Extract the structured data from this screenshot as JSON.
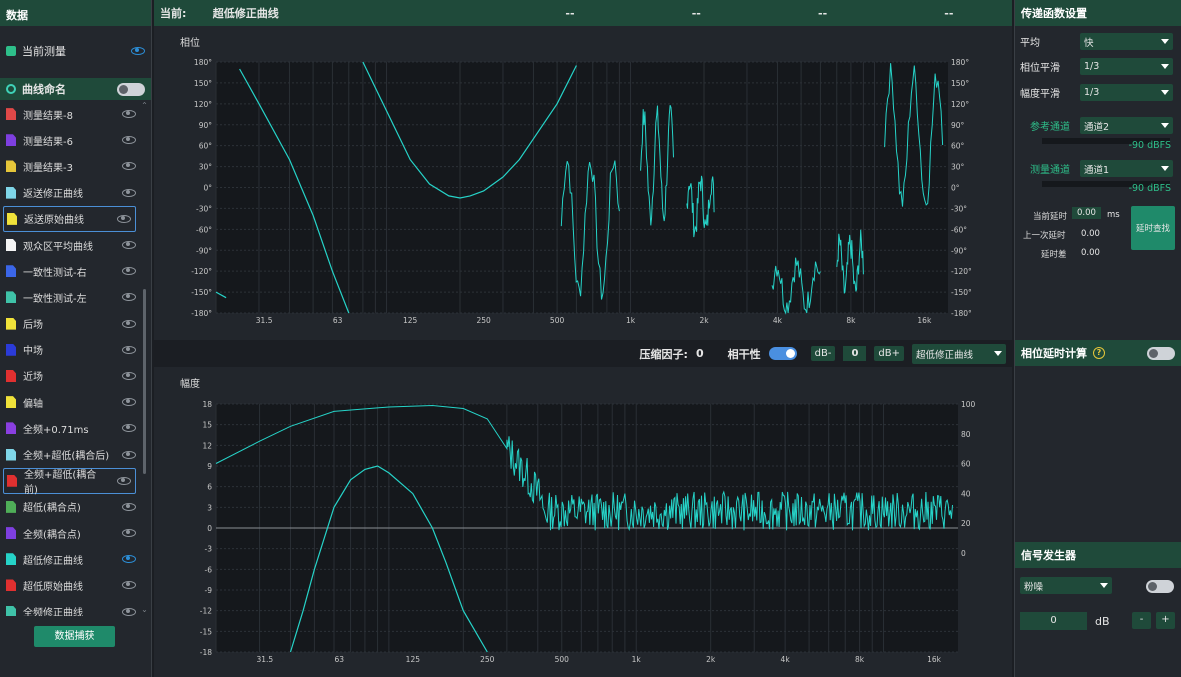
{
  "left": {
    "header": "数据",
    "current_measure": "当前测量",
    "curve_naming": "曲线命名",
    "items": [
      {
        "label": "测量结果-8",
        "color": "#e04848",
        "shape": "file",
        "eye": "off"
      },
      {
        "label": "测量结果-6",
        "color": "#7e3fe0",
        "shape": "file",
        "eye": "off"
      },
      {
        "label": "测量结果-3",
        "color": "#e5c63a",
        "shape": "file",
        "eye": "off"
      },
      {
        "label": "返送修正曲线",
        "color": "#7fd6e8",
        "shape": "file",
        "eye": "off"
      },
      {
        "label": "返送原始曲线",
        "color": "#f0e23a",
        "shape": "file",
        "eye": "off",
        "selected": true
      },
      {
        "label": "观众区平均曲线",
        "color": "#f4f4f4",
        "shape": "file",
        "eye": "off"
      },
      {
        "label": "一致性测试-右",
        "color": "#3b66e8",
        "shape": "file",
        "eye": "off"
      },
      {
        "label": "一致性测试-左",
        "color": "#3fc2a8",
        "shape": "file",
        "eye": "off"
      },
      {
        "label": "后场",
        "color": "#f0e23a",
        "shape": "file",
        "eye": "off"
      },
      {
        "label": "中场",
        "color": "#2b3bd8",
        "shape": "file",
        "eye": "off"
      },
      {
        "label": "近场",
        "color": "#e03030",
        "shape": "file",
        "eye": "off"
      },
      {
        "label": "偏轴",
        "color": "#f0e23a",
        "shape": "file",
        "eye": "off"
      },
      {
        "label": "全频+0.71ms",
        "color": "#8a3fe0",
        "shape": "file",
        "eye": "off"
      },
      {
        "label": "全频+超低(耦合后)",
        "color": "#7fd6e8",
        "shape": "file",
        "eye": "off"
      },
      {
        "label": "全频+超低(耦合前)",
        "color": "#e03030",
        "shape": "file",
        "eye": "off",
        "selected": true
      },
      {
        "label": "超低(耦合点)",
        "color": "#4fae58",
        "shape": "file",
        "eye": "off"
      },
      {
        "label": "全频(耦合点)",
        "color": "#7e3fe0",
        "shape": "file",
        "eye": "off"
      },
      {
        "label": "超低修正曲线",
        "color": "#26d3c8",
        "shape": "file",
        "eye": "on"
      },
      {
        "label": "超低原始曲线",
        "color": "#e03030",
        "shape": "file",
        "eye": "off"
      },
      {
        "label": "全频修正曲线",
        "color": "#3fc2a8",
        "shape": "file",
        "eye": "off"
      }
    ],
    "capture_button": "数据捕获"
  },
  "top_bar": {
    "label": "当前:",
    "curve": "超低修正曲线",
    "v1": "--",
    "v2": "--",
    "v3": "--",
    "v4": "--"
  },
  "phase_chart": {
    "title": "相位",
    "y_ticks": [
      "180°",
      "150°",
      "120°",
      "90°",
      "60°",
      "30°",
      "0°",
      "-30°",
      "-60°",
      "-90°",
      "-120°",
      "-150°",
      "-180°"
    ],
    "x_ticks": [
      "31.5",
      "63",
      "125",
      "250",
      "500",
      "1k",
      "2k",
      "4k",
      "8k",
      "16k"
    ]
  },
  "mid_bar": {
    "compress_label": "压缩因子:",
    "compress_value": "0",
    "coherence_label": "相干性",
    "db_minus": "dB-",
    "db_value": "0",
    "db_plus": "dB+",
    "curve_select": "超低修正曲线"
  },
  "mag_chart": {
    "title": "幅度",
    "y_ticks": [
      "18",
      "15",
      "12",
      "9",
      "6",
      "3",
      "0",
      "-3",
      "-6",
      "-9",
      "-12",
      "-15",
      "-18"
    ],
    "y2_ticks": [
      "100",
      "80",
      "60",
      "40",
      "20",
      "0"
    ],
    "x_ticks": [
      "31.5",
      "63",
      "125",
      "250",
      "500",
      "1k",
      "2k",
      "4k",
      "8k",
      "16k"
    ]
  },
  "chart_data": [
    {
      "type": "line",
      "title": "相位",
      "xlabel": "",
      "ylabel": "",
      "x_scale": "log",
      "xlim": [
        20,
        20000
      ],
      "ylim": [
        -180,
        180
      ],
      "series": [
        {
          "color": "#26d3c8",
          "x": [
            20,
            22,
            25,
            30,
            40,
            50,
            60,
            70,
            80,
            100,
            125,
            150,
            180,
            200,
            220,
            250,
            300,
            350,
            400,
            500,
            600
          ],
          "y": [
            -150,
            -158,
            170,
            120,
            40,
            -40,
            -120,
            -180,
            180,
            110,
            40,
            5,
            -12,
            -15,
            -12,
            -5,
            15,
            40,
            70,
            120,
            175
          ]
        }
      ]
    },
    {
      "type": "line",
      "title": "幅度",
      "xlabel": "",
      "ylabel": "",
      "x_scale": "log",
      "xlim": [
        20,
        20000
      ],
      "ylim": [
        -18,
        18
      ],
      "y2lim": [
        0,
        100
      ],
      "series": [
        {
          "color": "#26d3c8",
          "x": [
            40,
            45,
            50,
            60,
            70,
            80,
            90,
            100,
            125,
            150,
            170,
            200,
            250
          ],
          "y": [
            -18,
            -12,
            -6,
            3,
            7,
            8.5,
            9,
            8,
            5,
            0,
            -5,
            -12,
            -18
          ]
        },
        {
          "color": "#26d3c8",
          "axis": "right",
          "x": [
            20,
            30,
            40,
            60,
            100,
            150,
            200,
            250,
            300,
            400,
            1000,
            4000,
            16000
          ],
          "y": [
            60,
            75,
            85,
            95,
            98,
            99,
            97,
            90,
            70,
            35,
            25,
            25,
            30
          ]
        }
      ]
    }
  ],
  "right": {
    "tf_header": "传递函数设置",
    "avg_label": "平均",
    "avg_value": "快",
    "phase_smooth_label": "相位平滑",
    "phase_smooth_value": "1/3",
    "mag_smooth_label": "幅度平滑",
    "mag_smooth_value": "1/3",
    "ref_label": "参考通道",
    "ref_value": "通道2",
    "ref_level": "-90 dBFS",
    "meas_label": "测量通道",
    "meas_value": "通道1",
    "meas_level": "-90 dBFS",
    "cur_delay_label": "当前延时",
    "cur_delay_value": "0.00",
    "cur_delay_unit": "ms",
    "last_delay_label": "上一次延时",
    "last_delay_value": "0.00",
    "delay_diff_label": "延时差",
    "delay_diff_value": "0.00",
    "find_delay_button": "延时查找",
    "phase_delay_header": "相位延时计算",
    "help_glyph": "?",
    "gen_header": "信号发生器",
    "noise_select": "粉噪",
    "gen_value": "0",
    "gen_unit": "dB",
    "minus": "-",
    "plus": "+"
  }
}
